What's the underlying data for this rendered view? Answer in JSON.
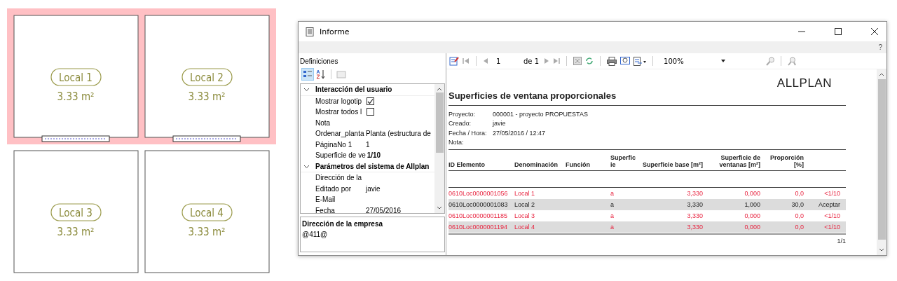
{
  "floor_plan": {
    "rooms": [
      {
        "name": "Local 1",
        "area": "3.33 m²",
        "highlighted": true,
        "has_window": true
      },
      {
        "name": "Local 2",
        "area": "3.33 m²",
        "highlighted": true,
        "has_window": true
      },
      {
        "name": "Local 3",
        "area": "3.33 m²",
        "highlighted": false,
        "has_window": false
      },
      {
        "name": "Local 4",
        "area": "3.33 m²",
        "highlighted": false,
        "has_window": false
      }
    ]
  },
  "window": {
    "title": "Informe",
    "help": "?"
  },
  "definitions": {
    "label": "Definiciones",
    "categories": [
      {
        "label": "Interacción del usuario",
        "expanded": true,
        "items": [
          {
            "kind": "checkbox",
            "label": "Mostrar logotip",
            "checked": true
          },
          {
            "kind": "checkbox",
            "label": "Mostrar todos l",
            "checked": false
          },
          {
            "kind": "text",
            "label": "Nota"
          },
          {
            "kind": "text",
            "label": "Ordenar_planta",
            "value": "Planta (estructura de"
          },
          {
            "kind": "text",
            "label": "PáginaNo 1",
            "value": "1"
          },
          {
            "kind": "text",
            "label": "Superficie de ve",
            "value": "1/10",
            "emphasized": true
          }
        ]
      },
      {
        "label": "Parámetros del sistema de Allplan",
        "expanded": true,
        "items": [
          {
            "kind": "text",
            "label": "Dirección de la"
          },
          {
            "kind": "text",
            "label": "Editado por",
            "value": "javie"
          },
          {
            "kind": "text",
            "label": "E-Mail"
          },
          {
            "kind": "text",
            "label": "Fecha",
            "value": "27/05/2016"
          }
        ]
      }
    ],
    "description": {
      "title": "Dirección de la empresa",
      "text": "@411@"
    }
  },
  "viewer_toolbar": {
    "page": "1",
    "page_total": "de 1",
    "zoom": "100%"
  },
  "report": {
    "logo": "ALLPLAN",
    "title": "Superficies de ventana proporcionales",
    "info": [
      {
        "label": "Proyecto:",
        "value": "000001 - proyecto PROPUESTAS"
      },
      {
        "label": "Creado:",
        "value": "javie"
      },
      {
        "label": "Fecha / Hora:",
        "value": "27/05/2016  /  12:47"
      },
      {
        "label": "Nota:"
      }
    ],
    "columns": [
      "ID Elemento",
      "Denominación",
      "Función",
      "Superficie",
      "Superficie base [m²]",
      "Superficie de ventanas [m²]",
      "Proporción [%]"
    ],
    "rows": [
      {
        "alert": true,
        "cells": [
          "0610Loc0000001056",
          "Local 1",
          "",
          "a",
          "3,330",
          "0,000",
          "0,0",
          "<1/10"
        ]
      },
      {
        "alert": false,
        "cells": [
          "0610Loc0000001083",
          "Local 2",
          "",
          "a",
          "3,330",
          "1,000",
          "30,0",
          "Aceptar"
        ]
      },
      {
        "alert": true,
        "cells": [
          "0610Loc0000001185",
          "Local 3",
          "",
          "a",
          "3,330",
          "0,000",
          "0,0",
          "<1/10"
        ]
      },
      {
        "alert": true,
        "cells": [
          "0610Loc0000001194",
          "Local 4",
          "",
          "a",
          "3,330",
          "0,000",
          "0,0",
          "<1/10"
        ]
      }
    ],
    "page_number": "1/1"
  }
}
